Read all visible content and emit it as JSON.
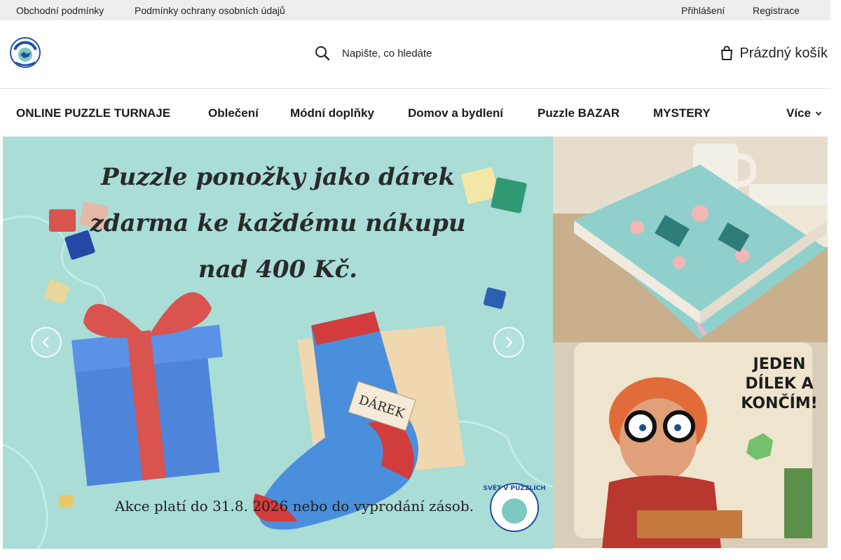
{
  "topbar": {
    "terms": "Obchodní podmínky",
    "privacy": "Podmínky ochrany osobních údajů",
    "login": "Přihlášení",
    "register": "Registrace"
  },
  "header": {
    "logo_icon": "svet-v-puzzlich-logo",
    "search_placeholder": "Napište, co hledáte",
    "search_icon": "search-icon",
    "cart_label": "Prázdný košík",
    "cart_icon": "cart-icon"
  },
  "nav": {
    "items": [
      "ONLINE PUZZLE TURNAJE",
      "Oblečení",
      "Módní doplňky",
      "Domov a bydlení",
      "Puzzle BAZAR",
      "MYSTERY"
    ],
    "more": "Více"
  },
  "hero": {
    "line1": "Puzzle ponožky jako dárek",
    "line2": "zdarma ke každému nákupu",
    "line3": "nad 400 Kč.",
    "tag": "DÁREK",
    "footer": "Akce platí do 31.8. 2026 nebo do vyprodání zásob.",
    "brand": "SVĚT V PUZZLÍCH"
  },
  "side_banner_2": {
    "text": "JEDEN DÍLEK A KONČÍM!"
  },
  "colors": {
    "topbar_bg": "#eeeeee",
    "hero_bg": "#a9ddd6",
    "text": "#1a1a1a"
  }
}
